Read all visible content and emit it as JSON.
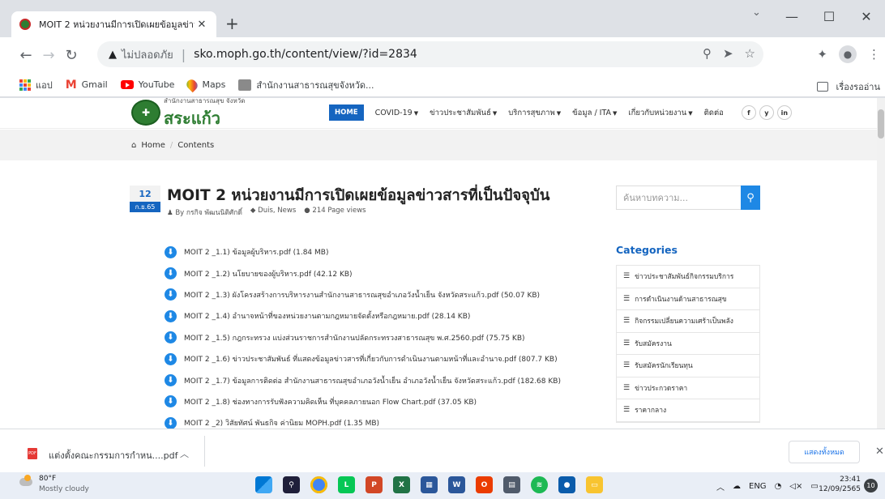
{
  "browser": {
    "tab_title": "MOIT 2 หน่วยงานมีการเปิดเผยข้อมูลข่าวสาร",
    "tab_close": "✕",
    "new_tab": "+",
    "insecure_label": "ไม่ปลอดภัย",
    "separator": "|",
    "url": "sko.moph.go.th/content/view/?id=2834"
  },
  "bookmarks": [
    {
      "label": "แอป",
      "icon": "apps-grid-icon"
    },
    {
      "label": "Gmail",
      "icon": "gmail-icon"
    },
    {
      "label": "YouTube",
      "icon": "youtube-icon"
    },
    {
      "label": "Maps",
      "icon": "maps-icon"
    },
    {
      "label": "สำนักงานสาธารณสุขจังหวัด...",
      "icon": "site-icon"
    }
  ],
  "reading_list": "เรื่องรออ่าน",
  "site": {
    "logo_sub": "สำนักงานสาธารณสุข จังหวัด",
    "logo_main": "สระแก้ว",
    "nav": {
      "home": "HOME",
      "items": [
        "COVID-19",
        "ข่าวประชาสัมพันธ์",
        "บริการสุขภาพ",
        "ข้อมูล / ITA",
        "เกี่ยวกับหน่วยงาน"
      ],
      "contact": "ติดต่อ"
    },
    "social": [
      "f",
      "y",
      "in"
    ],
    "breadcrumb": {
      "home": "Home",
      "slash": "/",
      "current": "Contents"
    }
  },
  "post": {
    "date_day": "12",
    "date_month": "ก.ย.65",
    "title": "MOIT 2 หน่วยงานมีการเปิดเผยข้อมูลข่าวสารที่เป็นปัจจุบัน",
    "author": "By กรกิจ พัฒนนิติศักดิ์",
    "tags": "Duis, News",
    "views": "214 Page views",
    "files": [
      "MOIT 2 _1.1) ข้อมูลผู้บริหาร.pdf (1.84 MB)",
      "MOIT 2 _1.2) นโยบายของผู้บริหาร.pdf (42.12 KB)",
      "MOIT 2 _1.3) ผังโครงสร้างการบริหารงานสำนักงานสาธารณสุขอำเภอวังน้ำเย็น จังหวัดสระแก้ว.pdf (50.07 KB)",
      "MOIT 2 _1.4) อำนาจหน้าที่ของหน่วยงานตามกฎหมายจัดตั้งหรือกฎหมาย.pdf (28.14 KB)",
      "MOIT 2 _1.5) กฎกระทรวง แบ่งส่วนราชการสำนักงานปลัดกระทรวงสาธารณสุข พ.ศ.2560.pdf (75.75 KB)",
      "MOIT 2 _1.6) ข่าวประชาสัมพันธ์ ที่แสดงข้อมูลข่าวสารที่เกี่ยวกับการดำเนินงานตามหน้าที่และอำนาจ.pdf (807.7 KB)",
      "MOIT 2 _1.7) ข้อมูลการติดต่อ สำนักงานสาธารณสุขอำเภอวังน้ำเย็น อำเภอวังน้ำเย็น จังหวัดสระแก้ว.pdf (182.68 KB)",
      "MOIT 2 _1.8) ช่องทางการรับฟังความคิดเห็น ที่บุคคลภายนอก Flow Chart.pdf (37.05 KB)",
      "MOIT 2 _2) วิสัยทัศน์ พันธกิจ ค่านิยม MOPH.pdf (1.35 MB)"
    ]
  },
  "sidebar": {
    "search_placeholder": "ค้นหาบทความ...",
    "categories_heading": "Categories",
    "categories": [
      "ข่าวประชาสัมพันธ์กิจกรรมบริการ",
      "การดำเนินงานด้านสาธารณสุข",
      "กิจกรรมเปลี่ยนความเศร้าเป็นพลัง",
      "รับสมัครงาน",
      "รับสมัครนักเรียนทุน",
      "ข่าวประกวดราคา",
      "ราคากลาง"
    ]
  },
  "download": {
    "filename": "แต่งตั้งคณะกรรมการกำหน....pdf",
    "file_badge": "PDF",
    "show_all": "แสดงทั้งหมด",
    "close": "✕"
  },
  "taskbar": {
    "temp": "80°F",
    "condition": "Mostly cloudy",
    "lang": "ENG",
    "time": "23:41",
    "date": "12/09/2565",
    "notifications": "10"
  }
}
